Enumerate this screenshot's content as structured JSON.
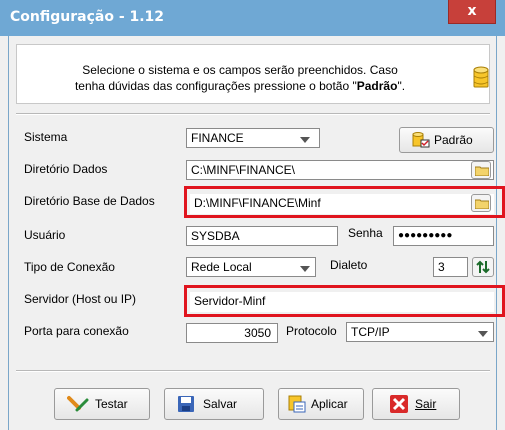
{
  "window": {
    "title": "Configuração - 1.12",
    "close_label": "x"
  },
  "info": {
    "line1": "Selecione o sistema e os campos serão preenchidos. Caso",
    "line2_pre": "tenha dúvidas das configurações pressione o botão \"",
    "line2_bold": "Padrão",
    "line2_post": "\"."
  },
  "form": {
    "sistema_label": "Sistema",
    "sistema_value": "FINANCE",
    "padrao_label": "Padrão",
    "diretorio_dados_label": "Diretório Dados",
    "diretorio_dados_value": "C:\\MINF\\FINANCE\\",
    "diretorio_base_label": "Diretório Base de Dados",
    "diretorio_base_value": "D:\\MINF\\FINANCE\\Minf",
    "usuario_label": "Usuário",
    "usuario_value": "SYSDBA",
    "senha_label": "Senha",
    "senha_value": "●●●●●●●●●",
    "tipo_conexao_label": "Tipo de Conexão",
    "tipo_conexao_value": "Rede Local",
    "dialeto_label": "Dialeto",
    "dialeto_value": "3",
    "servidor_label": "Servidor (Host ou IP)",
    "servidor_value": "Servidor-Minf",
    "porta_label": "Porta para conexão",
    "porta_value": "3050",
    "protocolo_label": "Protocolo",
    "protocolo_value": "TCP/IP"
  },
  "buttons": {
    "testar": "Testar",
    "salvar": "Salvar",
    "aplicar": "Aplicar",
    "sair": "Sair"
  },
  "colors": {
    "titlebar": "#6fa8d4",
    "close": "#c7403a",
    "highlight": "#e0141e"
  }
}
